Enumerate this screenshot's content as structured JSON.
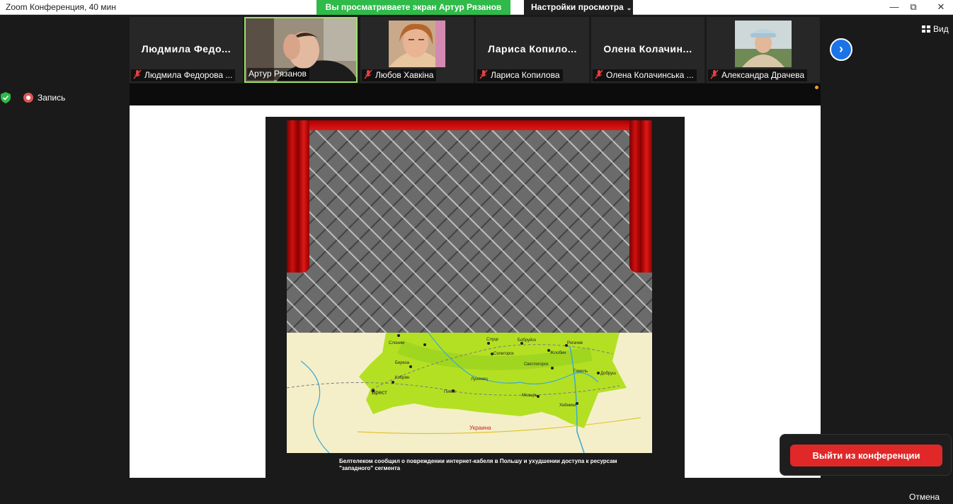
{
  "window": {
    "title": "Zoom Конференция, 40 мин"
  },
  "banner": {
    "viewing_text": "Вы просматриваете экран Артур Рязанов",
    "view_settings_label": "Настройки просмотра"
  },
  "participants": [
    {
      "big_name": "Людмила  Федо...",
      "label": "Людмила Федорова ...",
      "muted": true
    },
    {
      "big_name": "",
      "label": "Артур Рязанов",
      "muted": false
    },
    {
      "big_name": "",
      "label": "Любов Хавкіна",
      "muted": true
    },
    {
      "big_name": "Лариса  Копило...",
      "label": "Лариса Копилова",
      "muted": true
    },
    {
      "big_name": "Олена  Колачин...",
      "label": "Олена Колачинська ...",
      "muted": true
    },
    {
      "big_name": "",
      "label": "Александра Драчева",
      "muted": true
    }
  ],
  "view_button_label": "Вид",
  "recording_label": "Запись",
  "slide": {
    "map_labels": [
      "Брест",
      "Береза",
      "Кобрин",
      "Пинск",
      "Лунинец",
      "Слоним",
      "Слуцк",
      "Бобруйск",
      "Жлобин",
      "Рогачев",
      "Солигорск",
      "Светлогорск",
      "Гомель",
      "Добруш",
      "Мозырь",
      "Хойники",
      "Украина"
    ],
    "caption": "Белтелеком сообщил о повреждении интернет-кабеля в Польшу и ухудшении доступа к ресурсам \"западного\" сегмента"
  },
  "leave_button_label": "Выйти из конференции",
  "cancel_label": "Отмена",
  "colors": {
    "banner_green": "#2fba4a",
    "leave_red": "#e02828",
    "next_blue": "#1a73e8",
    "active_border": "#9ee06a"
  }
}
